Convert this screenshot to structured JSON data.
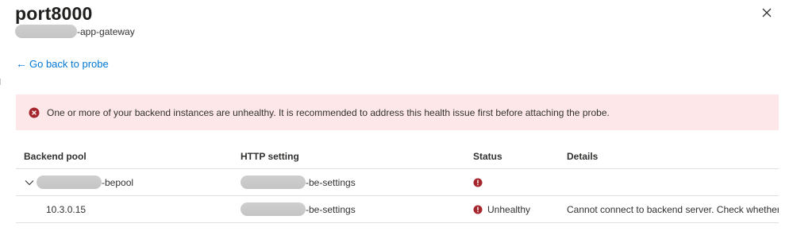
{
  "panel": {
    "title": "port8000",
    "subtitle_suffix": "-app-gateway"
  },
  "navigation": {
    "back_link": "Go back to probe"
  },
  "alert": {
    "message": "One or more of your backend instances are unhealthy. It is recommended to address this health issue first before attaching the probe.",
    "color": "#fde7e9",
    "icon_color": "#a4262c"
  },
  "table": {
    "headers": {
      "backend_pool": "Backend pool",
      "http_setting": "HTTP setting",
      "status": "Status",
      "details": "Details"
    },
    "rows": [
      {
        "pool_suffix": "-bepool",
        "http_suffix": "-be-settings",
        "status": "",
        "details": "",
        "expandable": true
      },
      {
        "pool": "10.3.0.15",
        "http_suffix": "-be-settings",
        "status": "Unhealthy",
        "details": "Cannot connect to backend server. Check whether ar"
      }
    ]
  },
  "colors": {
    "link": "#0078d4",
    "error": "#a4262c"
  }
}
